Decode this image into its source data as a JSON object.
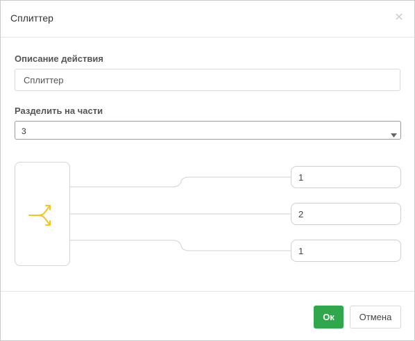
{
  "dialog": {
    "title": "Сплиттер",
    "close_icon": "close-icon"
  },
  "description": {
    "label": "Описание действия",
    "value": "Сплиттер"
  },
  "split": {
    "label": "Разделить на части",
    "selected": "3",
    "arrow_icon": "chevron-down-icon"
  },
  "splitter": {
    "icon": "split-arrows-icon",
    "icon_color": "#f5c518",
    "parts": [
      "1",
      "2",
      "1"
    ]
  },
  "footer": {
    "ok_label": "Ок",
    "cancel_label": "Отмена",
    "ok_color": "#2ea84a"
  }
}
